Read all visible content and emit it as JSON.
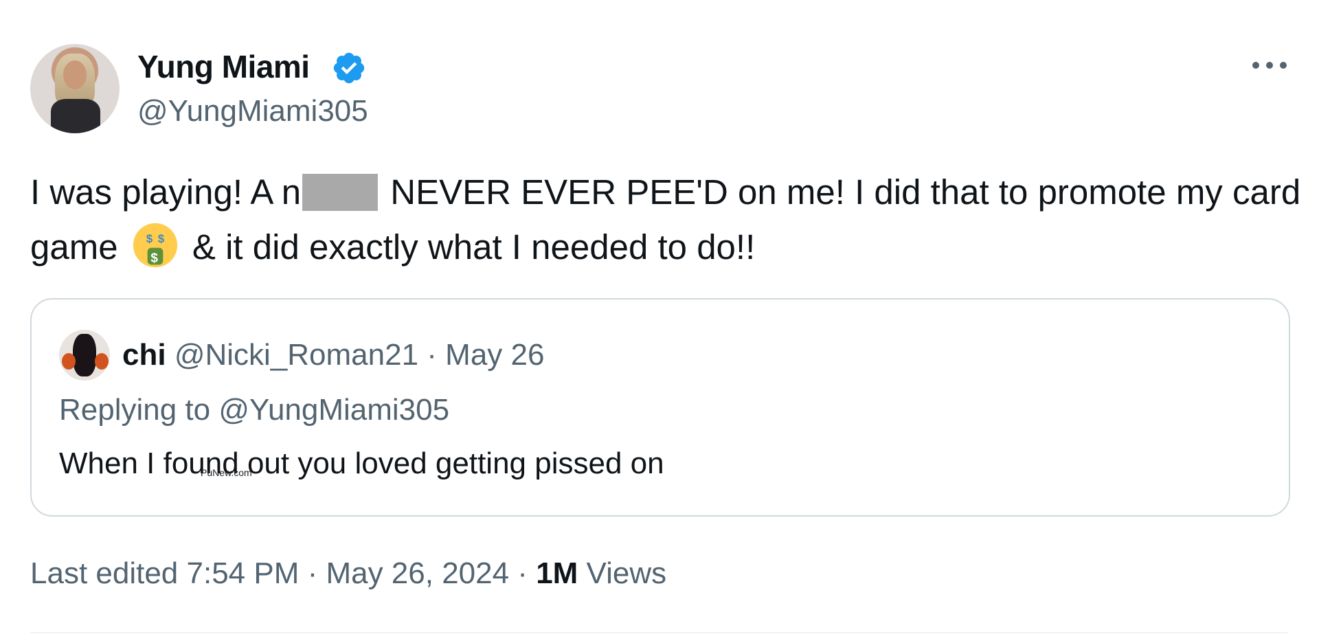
{
  "author": {
    "name": "Yung Miami",
    "handle": "@YungMiami305",
    "verified_icon": "verified-badge-icon",
    "accent_color": "#1d9bf0"
  },
  "tweet": {
    "text_before_redaction": "I was playing! A n",
    "text_after_redaction": " NEVER EVER PEE'D on me! I did that to promote my card game ",
    "emoji_icon": "money-mouth-face-emoji-icon",
    "text_after_emoji": " & it did exactly what I needed to do!!"
  },
  "quote": {
    "name": "chi",
    "handle": "@Nicki_Roman21",
    "separator": " · ",
    "date": "May 26",
    "replying_to": "Replying to @YungMiami305",
    "text": "When I found out you loved getting pissed on",
    "watermark": "PuNew.com"
  },
  "footer": {
    "edited": "Last edited 7:54 PM · May 26, 2024 · ",
    "views_count": "1M",
    "views_label": " Views"
  },
  "icons": {
    "more": "more-options-icon"
  }
}
